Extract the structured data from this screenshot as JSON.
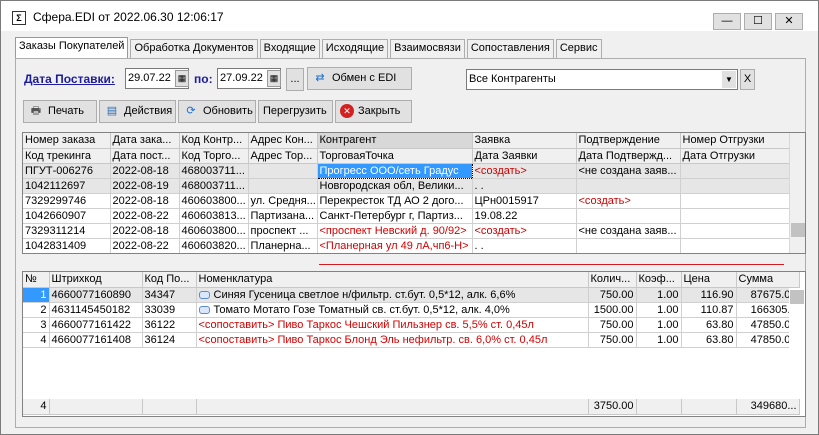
{
  "window": {
    "title": "Сфера.EDI от 2022.06.30 12:06:17",
    "app_icon": "Σ",
    "min": "—",
    "max": "☐",
    "close": "✕"
  },
  "tabs": [
    "Заказы Покупателей",
    "Обработка Документов",
    "Входящие",
    "Исходящие",
    "Взаимосвязи",
    "Сопоставления",
    "Сервис"
  ],
  "toolbar": {
    "date_label": "Дата Поставки:",
    "date_from": "29.07.22",
    "to_label": "по:",
    "date_to": "27.09.22",
    "ellipsis": "...",
    "exchange": "Обмен с EDI",
    "contractor_select": "Все Контрагенты",
    "clear": "X",
    "print": "Печать",
    "actions": "Действия",
    "refresh": "Обновить",
    "reload": "Перегрузить",
    "close": "Закрыть"
  },
  "orders": {
    "headers1": [
      "Номер заказа",
      "Дата зака...",
      "Код Контр...",
      "Адрес Кон...",
      "Контрагент",
      "Заявка",
      "Подтверждение",
      "Номер Отгрузки"
    ],
    "headers2": [
      "Код трекинга",
      "Дата пост...",
      "Код Торго...",
      "Адрес Тор...",
      "ТорговаяТочка",
      "Дата Заявки",
      "Дата Подтвержд...",
      "Дата Отгрузки"
    ],
    "rows": [
      [
        "ПГУТ-006276",
        "2022-08-18",
        "468003711...",
        "",
        "Прогресс ООО/сеть Градус",
        "<создать>",
        "<не создана заяв...",
        ""
      ],
      [
        "1042112697",
        "2022-08-19",
        "468003711...",
        "",
        "Новгородская обл, Велики...",
        ". .",
        "",
        ""
      ],
      [
        "7329299746",
        "2022-08-18",
        "460603800...",
        "ул. Средня...",
        "Перекресток ТД АО 2 дого...",
        "ЦРн0015917",
        "<создать>",
        ""
      ],
      [
        "1042660907",
        "2022-08-22",
        "460603813...",
        "Партизана...",
        "Санкт-Петербург г, Партиз...",
        "19.08.22",
        "",
        ""
      ],
      [
        "7329311214",
        "2022-08-18",
        "460603800...",
        "проспект ...",
        "<проспект Невский д. 90/92>",
        "<создать>",
        "<не создана заяв...",
        ""
      ],
      [
        "1042831409",
        "2022-08-22",
        "460603820...",
        "Планерна...",
        "<Планерная ул 49 лА,чп6-Н>",
        ". .",
        "",
        ""
      ]
    ]
  },
  "items": {
    "headers": [
      "№",
      "Штрихкод",
      "Код По...",
      "Номенклатура",
      "Колич...",
      "Коэф...",
      "Цена",
      "Сумма"
    ],
    "rows": [
      [
        "1",
        "4660077160890",
        "34347",
        "Синяя Гусеница светлое н/фильтр. ст.бут. 0,5*12, алк. 6,6%",
        "750.00",
        "1.00",
        "116.90",
        "87675.00"
      ],
      [
        "2",
        "4631145450182",
        "33039",
        "Томато Мотато Гозе Томатный св. ст.бут. 0,5*12, алк. 4,0%",
        "1500.00",
        "1.00",
        "110.87",
        "166305..."
      ],
      [
        "3",
        "4660077161422",
        "36122",
        "<сопоставить> Пиво Таркос Чешский Пильзнер св. 5,5% ст. 0,45л",
        "750.00",
        "1.00",
        "63.80",
        "47850.00"
      ],
      [
        "4",
        "4660077161408",
        "36124",
        "<сопоставить> Пиво Таркос Блонд Эль нефильтр. св. 6,0% ст. 0,45л",
        "750.00",
        "1.00",
        "63.80",
        "47850.00"
      ]
    ],
    "footer": {
      "count": "4",
      "qty_total": "3750.00",
      "sum_total": "349680..."
    }
  }
}
